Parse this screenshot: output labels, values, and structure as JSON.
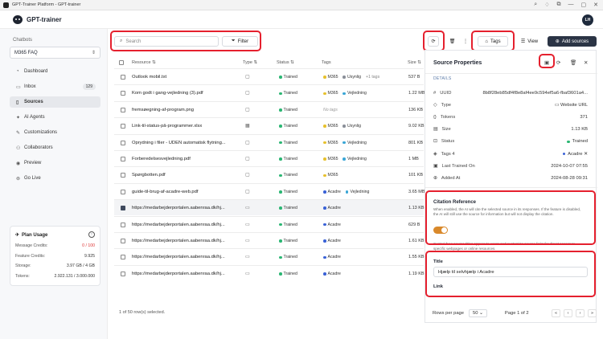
{
  "window": {
    "title": "GPT-Trainer Platform - GPT-trainer",
    "controls": [
      "⌕",
      "♢",
      "⧉",
      "—",
      "▢",
      "✕"
    ]
  },
  "app": {
    "brand": "GPT-trainer",
    "avatar": "LH"
  },
  "sidebar": {
    "label": "Chatbots",
    "chatbot": "M365 FAQ",
    "items": [
      {
        "label": "Dashboard",
        "icon": "◔"
      },
      {
        "label": "Inbox",
        "icon": "▭",
        "badge": "129"
      },
      {
        "label": "Sources",
        "icon": "▯"
      },
      {
        "label": "AI Agents",
        "icon": "✦"
      },
      {
        "label": "Customizations",
        "icon": "✎"
      },
      {
        "label": "Collaborators",
        "icon": "⚇"
      },
      {
        "label": "Preview",
        "icon": "◉"
      },
      {
        "label": "Go Live",
        "icon": "⊚"
      }
    ],
    "plan": {
      "title": "Plan Usage",
      "rows": [
        {
          "k": "Message Credits:",
          "v": "0 / 100"
        },
        {
          "k": "Feature Credits:",
          "v": "9.925"
        },
        {
          "k": "Storage:",
          "v": "3.97 GB / 4 GB"
        },
        {
          "k": "Tokens:",
          "v": "2.922.131 / 3.000.000"
        }
      ]
    }
  },
  "toolbar": {
    "search_placeholder": "Search",
    "filter": "Filter",
    "refresh_icon": "⟳",
    "trash_icon": "🗑",
    "more_icon": "⋮",
    "tags": "Tags",
    "view": "View",
    "add_sources": "Add sources"
  },
  "table": {
    "headers": {
      "resource": "Resource ⇅",
      "type": "Type ⇅",
      "status": "Status ⇅",
      "tags": "Tags",
      "size": "Size ⇅"
    },
    "rows": [
      {
        "name": "Outlook mobil.txt",
        "type": "▢",
        "status": "Trained",
        "tags": [
          {
            "t": "M365",
            "c": "#e7c12e"
          },
          {
            "t": "Usynlig",
            "c": "#8a8f98"
          },
          {
            "t": "+1 tags",
            "c": ""
          }
        ],
        "size": "537 B",
        "sel": false
      },
      {
        "name": "Kom godt i gang-vejledning (3).pdf",
        "type": "▢",
        "status": "Trained",
        "tags": [
          {
            "t": "M365",
            "c": "#e7c12e"
          },
          {
            "t": "Vejledning",
            "c": "#3aa6d6"
          }
        ],
        "size": "1.22 MB",
        "sel": false
      },
      {
        "name": "fremsøegning-af-program.png",
        "type": "▢",
        "status": "Trained",
        "tags": [
          {
            "t": "No tags",
            "c": "none"
          }
        ],
        "size": "136 KB",
        "sel": false
      },
      {
        "name": "Link-til-status-på-programmer.xlsx",
        "type": "▦",
        "status": "Trained",
        "tags": [
          {
            "t": "M365",
            "c": "#e7c12e"
          },
          {
            "t": "Usynlig",
            "c": "#8a8f98"
          }
        ],
        "size": "9.02 KB",
        "sel": false
      },
      {
        "name": "Oprydning i filer - UDEN automatisk flytning...",
        "type": "▢",
        "status": "Trained",
        "tags": [
          {
            "t": "M365",
            "c": "#e7c12e"
          },
          {
            "t": "Vejledning",
            "c": "#3aa6d6"
          }
        ],
        "size": "801 KB",
        "sel": false
      },
      {
        "name": "Forberedelsesvejledning.pdf",
        "type": "▢",
        "status": "Trained",
        "tags": [
          {
            "t": "M365",
            "c": "#e7c12e"
          },
          {
            "t": "Vejledning",
            "c": "#3aa6d6"
          }
        ],
        "size": "1 MB",
        "sel": false
      },
      {
        "name": "Spørgbotten.pdf",
        "type": "▢",
        "status": "Trained",
        "tags": [
          {
            "t": "M365",
            "c": "#e7c12e"
          }
        ],
        "size": "101 KB",
        "sel": false
      },
      {
        "name": "guide-til-brug-af-acadre-web.pdf",
        "type": "▢",
        "status": "Trained",
        "tags": [
          {
            "t": "Acadre",
            "c": "#3a62d6"
          },
          {
            "t": "Vejledning",
            "c": "#3aa6d6"
          }
        ],
        "size": "3.65 MB",
        "sel": false
      },
      {
        "name": "https://medarbejderportalen.aabenraa.dk/hj...",
        "type": "▭",
        "status": "Trained",
        "tags": [
          {
            "t": "Acadre",
            "c": "#3a62d6"
          }
        ],
        "size": "1.13 KB",
        "sel": true
      },
      {
        "name": "https://medarbejderportalen.aabenraa.dk/hj...",
        "type": "▭",
        "status": "Trained",
        "tags": [
          {
            "t": "Acadre",
            "c": "#3a62d6"
          }
        ],
        "size": "629 B",
        "sel": false
      },
      {
        "name": "https://medarbejderportalen.aabenraa.dk/hj...",
        "type": "▭",
        "status": "Trained",
        "tags": [
          {
            "t": "Acadre",
            "c": "#3a62d6"
          }
        ],
        "size": "1.61 KB",
        "sel": false
      },
      {
        "name": "https://medarbejderportalen.aabenraa.dk/hj...",
        "type": "▭",
        "status": "Trained",
        "tags": [
          {
            "t": "Acadre",
            "c": "#3a62d6"
          }
        ],
        "size": "1.55 KB",
        "sel": false
      },
      {
        "name": "https://medarbejderportalen.aabenraa.dk/hj...",
        "type": "▭",
        "status": "Trained",
        "tags": [
          {
            "t": "Acadre",
            "c": "#3a62d6"
          }
        ],
        "size": "1.19 KB",
        "sel": false
      }
    ],
    "footer": "1 of 50 row(s) selected."
  },
  "panel": {
    "title": "Source Properties",
    "section": "DETAILS",
    "details": [
      {
        "icon": "#",
        "k": "UUID",
        "v": "8b8f28eb85df4f8e8af4ee9c594ef5a6-fbaf3601a4..."
      },
      {
        "icon": "◇",
        "k": "Type",
        "v": "▭ Website URL"
      },
      {
        "icon": "{}",
        "k": "Tokens",
        "v": "371"
      },
      {
        "icon": "▤",
        "k": "Size",
        "v": "1.13 KB"
      },
      {
        "icon": "⊡",
        "k": "Status",
        "v": "Trained"
      },
      {
        "icon": "◈",
        "k": "Tags 4",
        "v": "Acadre ✕"
      },
      {
        "icon": "▣",
        "k": "Last Trained On",
        "v": "2024-10-07 07:55"
      },
      {
        "icon": "⊕",
        "k": "Added At",
        "v": "2024-08-28 09:31"
      }
    ],
    "citation": {
      "title": "Citation Reference",
      "desc": "When enabled, the AI will cite the selected source in its responses. If the feature is disabled, the AI will still use the source for information but will not display the citation."
    },
    "control_desc": "Control how source titles appear to users and customize source links for direct access to specific webpages or online resources.",
    "title_label": "Title",
    "title_value": "Hjælp til selvhjælp i Acadre",
    "link_label": "Link"
  },
  "pager": {
    "rows_label": "Rows per page",
    "rows_value": "50 ⌄",
    "page": "Page 1 of 2",
    "buttons": [
      "«",
      "‹",
      "›",
      "»"
    ]
  },
  "colors": {
    "trained": "#2bb673",
    "highlight": "#e5202e",
    "accent": "#d9892b"
  }
}
